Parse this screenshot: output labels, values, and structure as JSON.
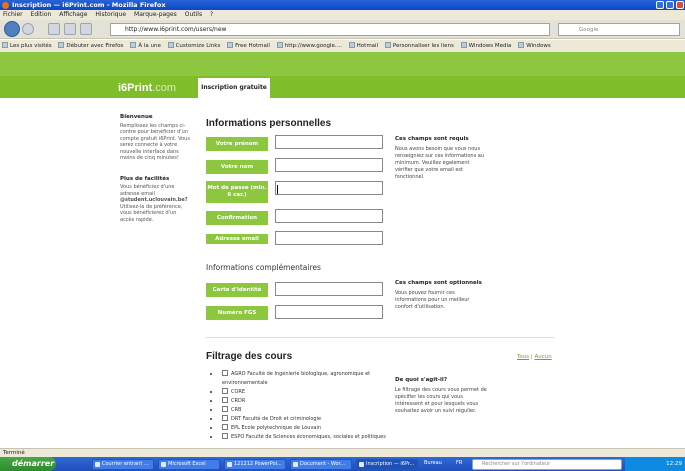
{
  "window": {
    "title": "Inscription — i6Print.com - Mozilla Firefox"
  },
  "menu": [
    "Fichier",
    "Edition",
    "Affichage",
    "Historique",
    "Marque-pages",
    "Outils",
    "?"
  ],
  "nav": {
    "url": "http://www.i6print.com/users/new",
    "search_placeholder": "Google"
  },
  "bookmarks": [
    "Les plus visités",
    "Débuter avec Firefox",
    "À la une",
    "Customize Links",
    "Free Hotmail",
    "http://www.google....",
    "Hotmail",
    "Personnaliser les liens",
    "Windows Media",
    "Windows"
  ],
  "site": {
    "logo_main": "i6Print",
    "logo_suffix": ".com",
    "tab": "Inscription gratuite"
  },
  "sidebar": {
    "welcome_title": "Bienvenue",
    "welcome_text": "Remplissez les champs ci-contre pour bénéficier d'un compte gratuit i6Print. Vous serez connecté à votre nouvelle interface dans moins de cinq minutes!",
    "perks_title": "Plus de facilités",
    "perks_text_1": "Vous bénéficiez d'une adresse email",
    "perks_email": "@student.uclouvain.be?",
    "perks_text_2": "Utilisez-la de préférence, vous bénéficierez d'un accès rapide."
  },
  "form": {
    "title": "Informations personnelles",
    "fields": [
      "Votre prénom",
      "Votre nom",
      "Mot de passe (min. 6 car.)",
      "Confirmation",
      "Adresse email"
    ],
    "required_title": "Ces champs sont requis",
    "required_text": "Nous avons besoin que vous nous renseigniez sur ces informations au minimum. Veuillez également vérifier que votre email est fonctionnel.",
    "extra_title": "Informations complémentaires",
    "extra_fields": [
      "Carte d'identité",
      "Numéro FGS"
    ],
    "optional_title": "Ces champs sont optionnels",
    "optional_text": "Vous pouvez fournir ces informations pour un meilleur confort d'utilisation."
  },
  "filter": {
    "title": "Filtrage des cours",
    "all": "Tous",
    "none": "Aucun",
    "courses": [
      "AGRO Faculté de Ingénierie biologique, agronomique et environnementale",
      "CORE",
      "CRDR",
      "CRB",
      "DRT Faculté de Droit et criminologie",
      "EPL Ecole polytechnique de Louvain",
      "ESPO Faculté de Sciences économiques, sociales et politiques"
    ],
    "info_title": "De quoi s'agit-il?",
    "info_text": "Le filtrage des cours vous permet de spécifier les cours qui vous intéressent et pour lesquels vous souhaitez avoir un suivi régulier."
  },
  "status": "Terminé",
  "taskbar": {
    "start": "démarrer",
    "tasks": [
      "Courrier entrant ...",
      "Microsoft Excel",
      "121212 PowerPoi...",
      "Document - Wor...",
      "Inscription — i6Pr...",
      "Bureau",
      "FR",
      "Rechercher sur l'ordinateur"
    ],
    "clock": "12:29"
  },
  "colors": {
    "brand_green": "#8dc63f",
    "brand_green_dark": "#7fbe2a"
  }
}
